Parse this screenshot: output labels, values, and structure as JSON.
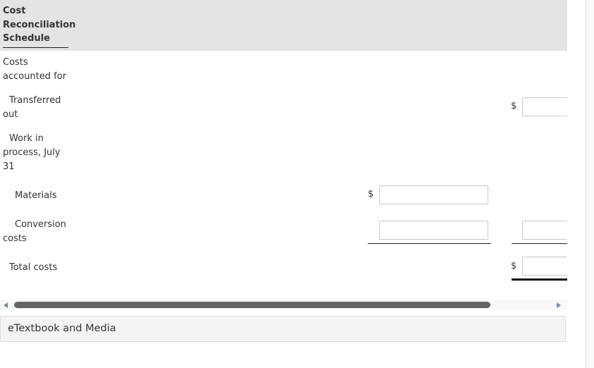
{
  "schedule": {
    "title": "Cost Reconciliation Schedule",
    "section_label": "Costs accounted for",
    "rows": {
      "transferred_out": {
        "label": "Transferred out",
        "currency": "$",
        "value": ""
      },
      "wip_header": {
        "label": "Work in process, July 31"
      },
      "materials": {
        "label": "Materials",
        "currency": "$",
        "value": ""
      },
      "conversion_costs": {
        "label": "Conversion costs",
        "value": "",
        "wip_total_value": ""
      },
      "total_costs": {
        "label": "Total costs",
        "currency": "$",
        "value": ""
      }
    }
  },
  "footer": {
    "etextbook_label": "eTextbook and Media"
  }
}
